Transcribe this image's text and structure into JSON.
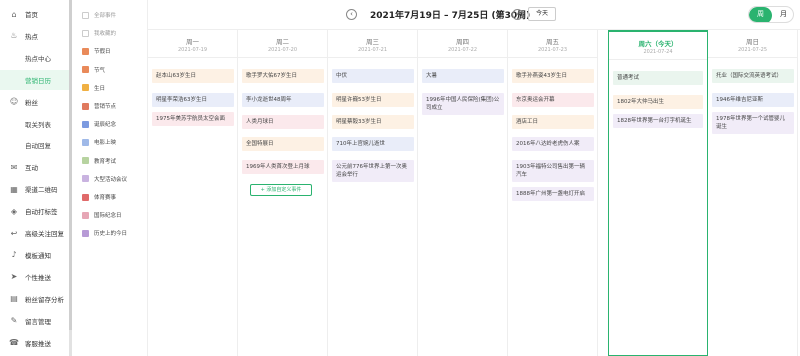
{
  "sidebar": {
    "items": [
      {
        "label": "首页",
        "icon": "home-icon",
        "glyph": "⌂"
      },
      {
        "label": "热点",
        "icon": "flame-icon",
        "glyph": "♨"
      },
      {
        "label": "热点中心",
        "sub": true
      },
      {
        "label": "营销日历",
        "sub": true,
        "active": true
      },
      {
        "label": "粉丝",
        "icon": "user-icon",
        "glyph": "☺"
      },
      {
        "label": "取关列表",
        "sub": true
      },
      {
        "label": "自动回复",
        "sub": true
      },
      {
        "label": "互动",
        "icon": "chat-icon",
        "glyph": "✉"
      },
      {
        "label": "渠道二维码",
        "icon": "qrcode-icon",
        "glyph": "▦"
      },
      {
        "label": "自动打标签",
        "icon": "tag-icon",
        "glyph": "◈"
      },
      {
        "label": "高级关注回复",
        "icon": "reply-icon",
        "glyph": "↩"
      },
      {
        "label": "模板通知",
        "icon": "bell-icon",
        "glyph": "♪"
      },
      {
        "label": "个性推送",
        "icon": "send-icon",
        "glyph": "➤"
      },
      {
        "label": "粉丝留存分析",
        "icon": "chart-icon",
        "glyph": "▤"
      },
      {
        "label": "留言管理",
        "icon": "comment-icon",
        "glyph": "✎"
      },
      {
        "label": "客服推送",
        "icon": "service-icon",
        "glyph": "☎"
      }
    ]
  },
  "filters": [
    {
      "label": "全部事件",
      "color": "#cccccc",
      "muted": true
    },
    {
      "label": "我收藏的",
      "color": "#cccccc",
      "muted": true
    },
    {
      "label": "节假日",
      "color": "#e98a5a"
    },
    {
      "label": "节气",
      "color": "#e98a5a"
    },
    {
      "label": "生日",
      "color": "#f0b043"
    },
    {
      "label": "营销节点",
      "color": "#e07a5f"
    },
    {
      "label": "诞辰纪念",
      "color": "#7c9ae0"
    },
    {
      "label": "电影上映",
      "color": "#9fb9e8"
    },
    {
      "label": "教育考试",
      "color": "#b7d3a0"
    },
    {
      "label": "大型活动会议",
      "color": "#c9b3e0"
    },
    {
      "label": "体育赛事",
      "color": "#e06a6a"
    },
    {
      "label": "国际纪念日",
      "color": "#e6a6b5"
    },
    {
      "label": "历史上的今日",
      "color": "#b79ad6"
    }
  ],
  "header": {
    "prev": "‹",
    "next": "›",
    "week_title": "2021年7月19日 – 7月25日 (第30周)",
    "today": "今天",
    "view_week": "周",
    "view_month": "月"
  },
  "days": [
    {
      "name": "周一",
      "date": "2021-07-19",
      "events": [
        {
          "text": "赵本山63岁生日",
          "color": "orange"
        },
        {
          "text": "明星李荣浩63岁生日",
          "color": "blue"
        },
        {
          "text": "1975年美苏宇航员太空会面",
          "color": "pink"
        }
      ]
    },
    {
      "name": "周二",
      "date": "2021-07-20",
      "events": [
        {
          "text": "歌手罗大佑67岁生日",
          "color": "orange"
        },
        {
          "text": "李小龙逝世48周年",
          "color": "blue"
        },
        {
          "text": "人类月球日",
          "color": "pink"
        },
        {
          "text": "全国特展日",
          "color": "orange"
        },
        {
          "text": "1969年人类首次登上月球",
          "color": "pink"
        }
      ],
      "add": "+ 添加自定义事件"
    },
    {
      "name": "周三",
      "date": "2021-07-21",
      "events": [
        {
          "text": "中伏",
          "color": "blue"
        },
        {
          "text": "明星许巍53岁生日",
          "color": "orange"
        },
        {
          "text": "明星蔡毅33岁生日",
          "color": "orange"
        },
        {
          "text": "710年上官婉儿逝世",
          "color": "blue"
        },
        {
          "text": "公元前776年世界上第一次奥运会举行",
          "color": "purple"
        }
      ]
    },
    {
      "name": "周四",
      "date": "2021-07-22",
      "events": [
        {
          "text": "大暑",
          "color": "blue"
        },
        {
          "text": "1996年中国人民保险(集团)公司成立",
          "color": "purple"
        }
      ]
    },
    {
      "name": "周五",
      "date": "2021-07-23",
      "events": [
        {
          "text": "歌手孙燕姿43岁生日",
          "color": "orange"
        },
        {
          "text": "东京奥运会开幕",
          "color": "pink"
        },
        {
          "text": "酒店工日",
          "color": "orange"
        },
        {
          "text": "2016年八达岭老虎伤人案",
          "color": "purple"
        },
        {
          "text": "1903年福特公司售出第一辆汽车",
          "color": "purple"
        },
        {
          "text": "1888年广州第一盏电灯开启",
          "color": "purple"
        }
      ]
    },
    {
      "name": "周六（今天）",
      "date": "2021-07-24",
      "today": true,
      "events": [
        {
          "text": "普通考试",
          "color": "green"
        },
        {
          "text": "1802年大仲马出生",
          "color": "orange"
        },
        {
          "text": "1828年世界第一台打字机诞生",
          "color": "purple"
        }
      ]
    },
    {
      "name": "周日",
      "date": "2021-07-25",
      "events": [
        {
          "text": "托业（国际交流英语考试）",
          "color": "green"
        },
        {
          "text": "1946年维吉尼亚斯",
          "color": "blue"
        },
        {
          "text": "1978年世界第一个试管婴儿诞生",
          "color": "purple"
        }
      ]
    }
  ]
}
